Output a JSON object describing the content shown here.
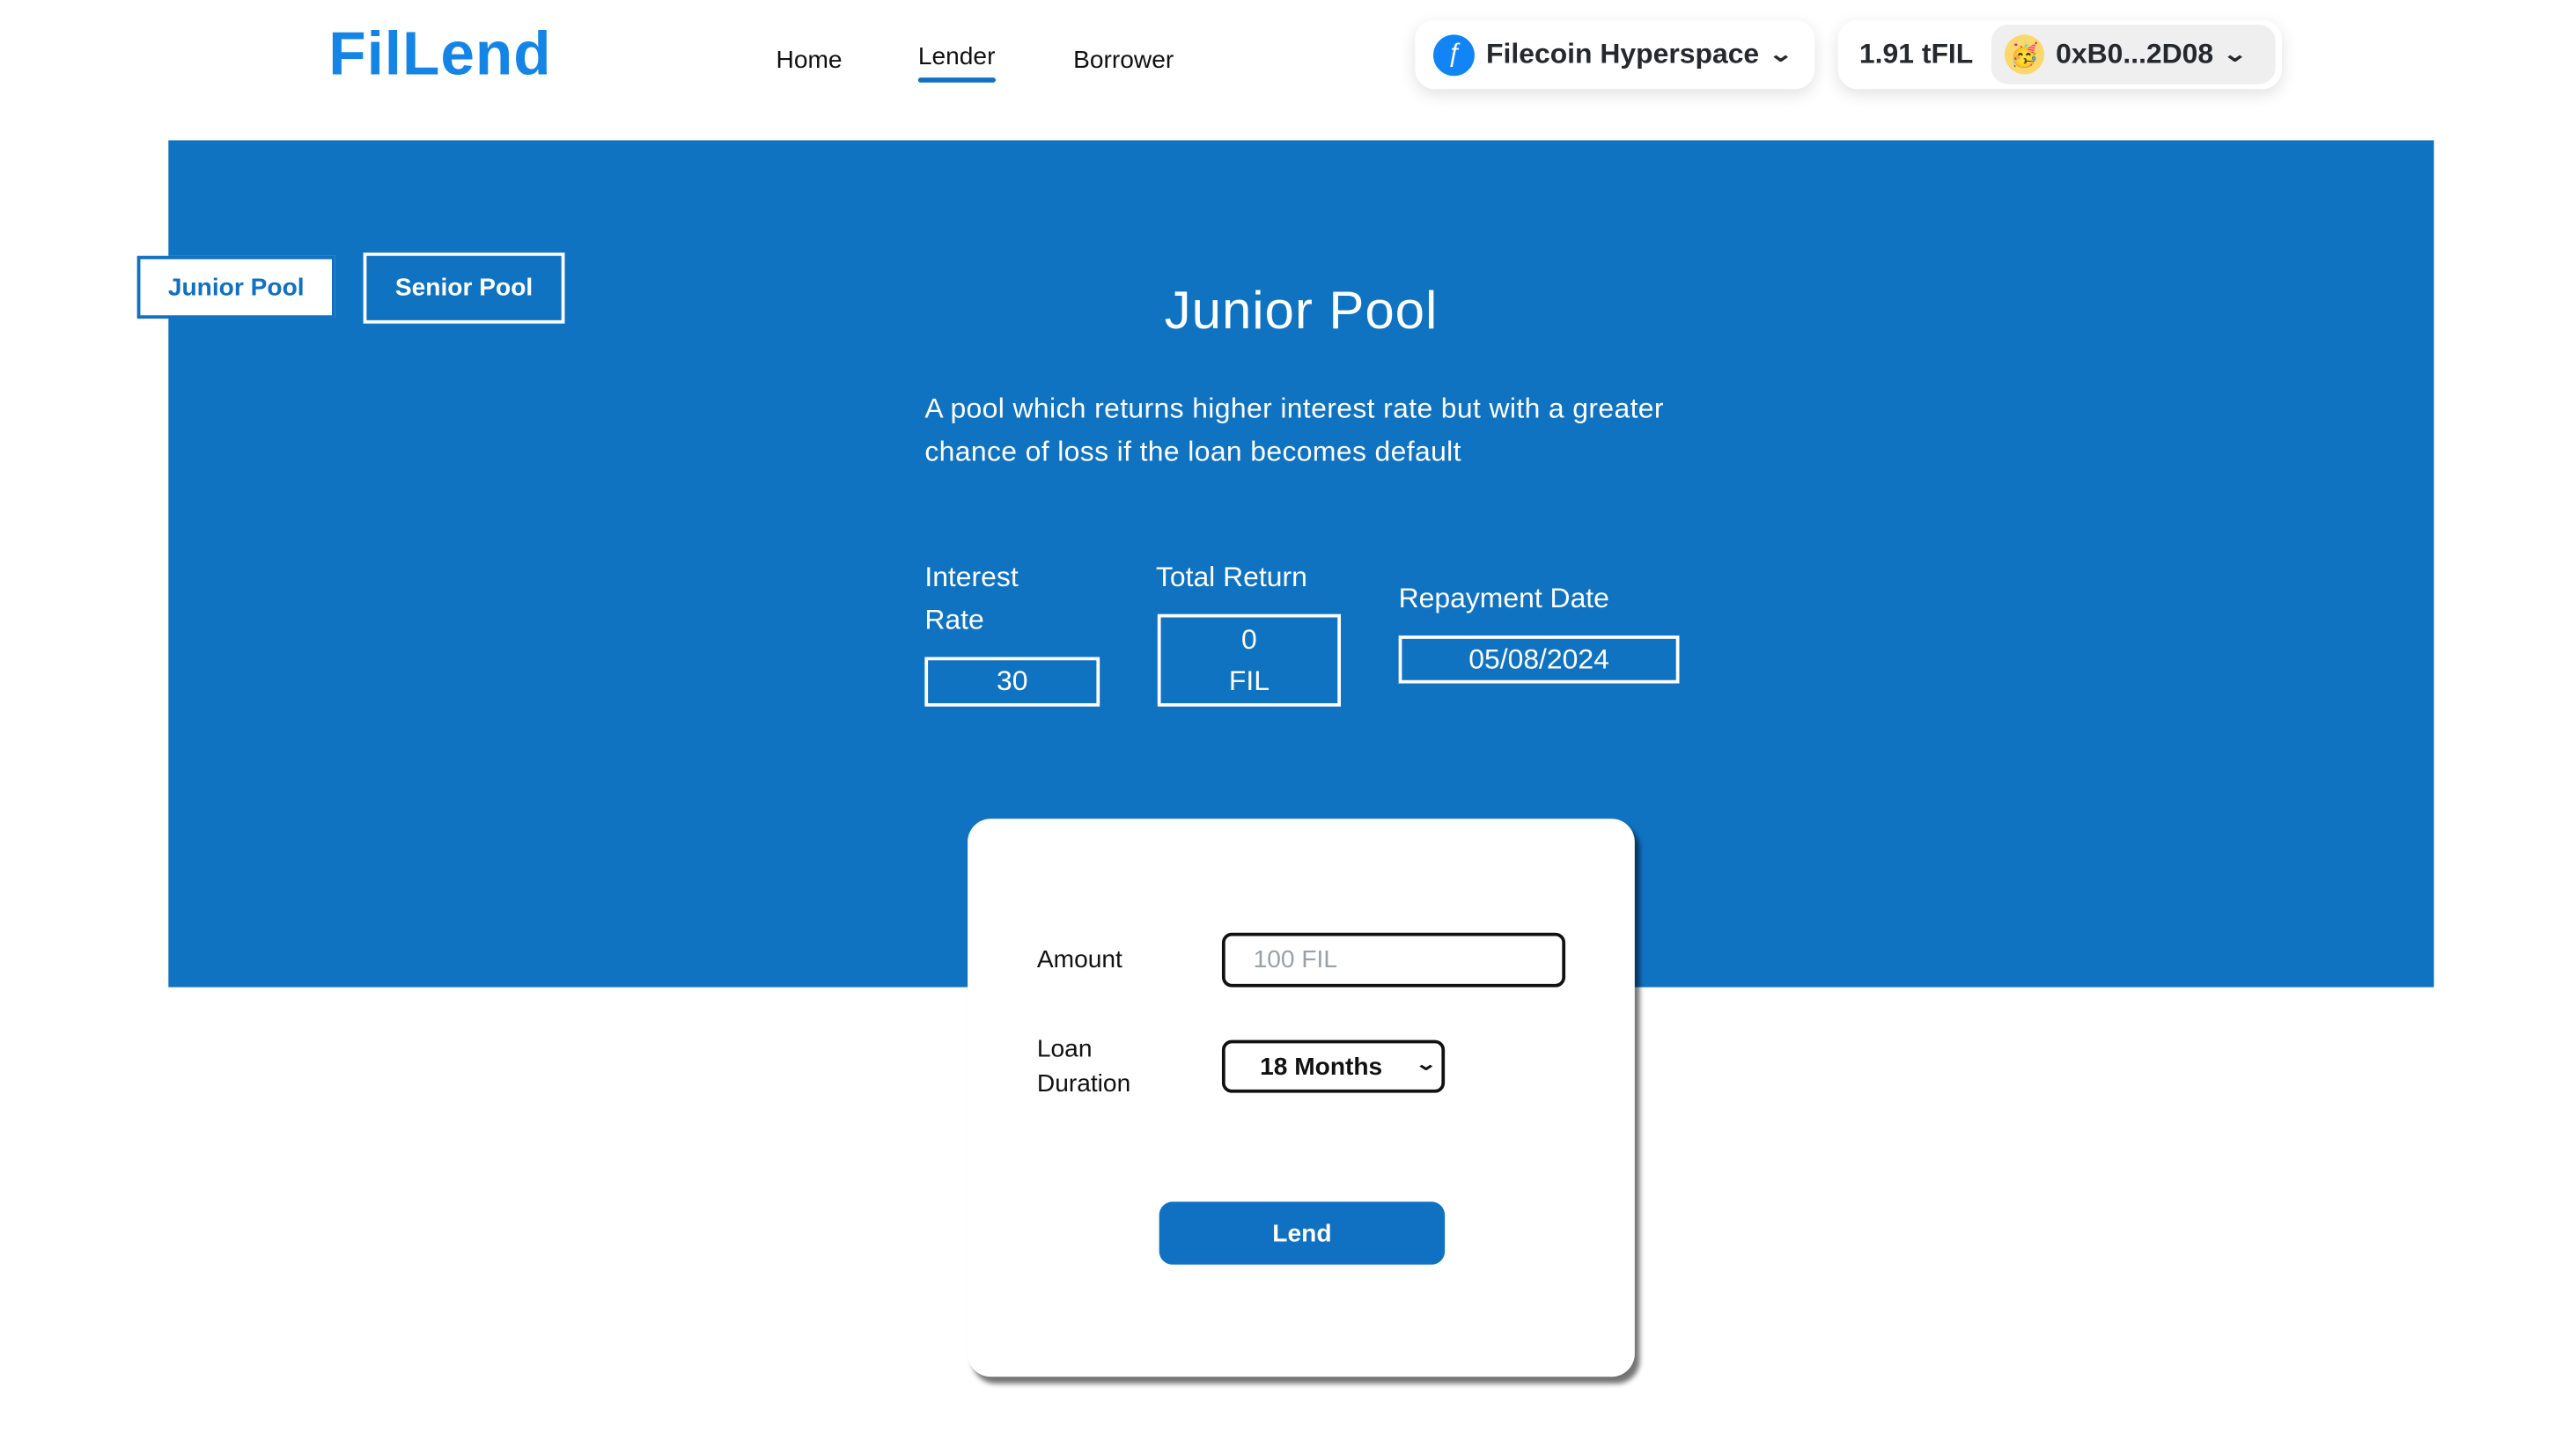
{
  "header": {
    "logo": "FilLend",
    "nav": [
      {
        "label": "Home"
      },
      {
        "label": "Lender",
        "active": true
      },
      {
        "label": "Borrower"
      }
    ],
    "network": {
      "label": "Filecoin Hyperspace",
      "icon": "filecoin-icon"
    },
    "balance": "1.91 tFIL",
    "account": {
      "address": "0xB0...2D08",
      "avatar": "🥳"
    }
  },
  "colors": {
    "primary": "#0f73c2",
    "logo": "#1485e6"
  },
  "tabs": [
    {
      "label": "Junior Pool",
      "selected": true
    },
    {
      "label": "Senior Pool"
    }
  ],
  "pool": {
    "title": "Junior Pool",
    "description": "A pool which returns higher interest rate but with a greater chance of loss if the loan becomes default",
    "interest_rate": {
      "label_1": "Interest",
      "label_2": "Rate",
      "value": "30"
    },
    "total_return": {
      "label": "Total Return",
      "value": "0",
      "unit": "FIL"
    },
    "repayment_date": {
      "label": "Repayment Date",
      "value": "05/08/2024"
    }
  },
  "form": {
    "amount_label": "Amount",
    "amount_placeholder": "100 FIL",
    "duration_label_1": "Loan",
    "duration_label_2": "Duration",
    "duration_value": "18 Months",
    "lend_label": "Lend"
  }
}
